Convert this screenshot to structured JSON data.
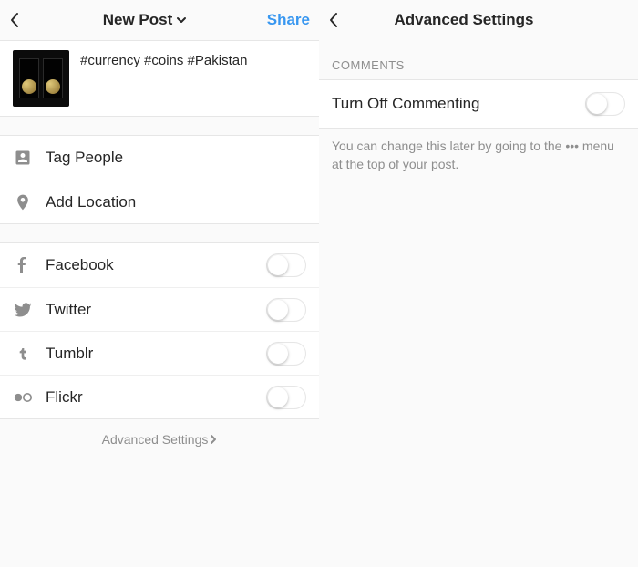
{
  "left": {
    "header": {
      "title": "New Post",
      "share_label": "Share"
    },
    "caption": "#currency #coins #Pakistan",
    "tag_people_label": "Tag People",
    "add_location_label": "Add Location",
    "share_targets": [
      {
        "name": "Facebook",
        "icon": "facebook"
      },
      {
        "name": "Twitter",
        "icon": "twitter"
      },
      {
        "name": "Tumblr",
        "icon": "tumblr"
      },
      {
        "name": "Flickr",
        "icon": "flickr"
      }
    ],
    "advanced_link_label": "Advanced Settings"
  },
  "right": {
    "header": {
      "title": "Advanced Settings"
    },
    "comments_section_label": "COMMENTS",
    "turn_off_label": "Turn Off Commenting",
    "help_text": "You can change this later by going to the ••• menu at the top of your post."
  }
}
